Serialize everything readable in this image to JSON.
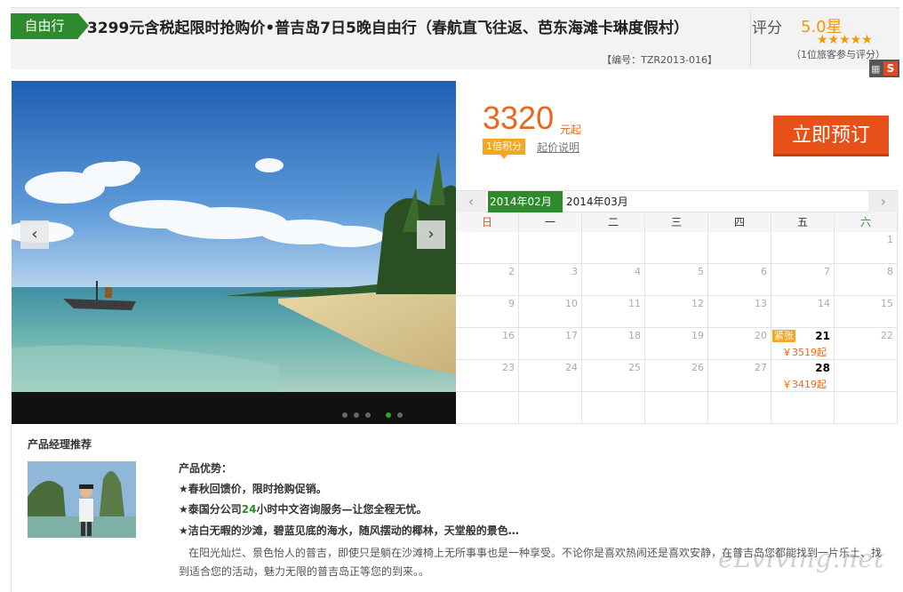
{
  "header": {
    "tag": "自由行",
    "title": "3299元含税起限时抢购价•普吉岛7日5晚自由行（春航直飞往返、芭东海滩卡琳度假村）",
    "code": "【编号：TZR2013-016】",
    "rating_label": "评分",
    "rating_value": "5.0星",
    "stars": "★★★★★",
    "reviews": "（1位旅客参与评分）"
  },
  "slider": {
    "prev_icon": "‹",
    "next_icon": "›",
    "total_slides": 5,
    "active_slide": 4
  },
  "price": {
    "amount": "3320",
    "unit": "元起",
    "points": "1倍积分",
    "note": "起价说明",
    "book_button": "立即预订"
  },
  "calendar": {
    "prev_icon": "‹",
    "next_icon": "›",
    "months": [
      "2014年02月",
      "2014年03月"
    ],
    "weekdays": [
      "日",
      "一",
      "二",
      "三",
      "四",
      "五",
      "六"
    ],
    "weekday_colors": [
      "#e8501a",
      "#333333",
      "#333333",
      "#333333",
      "#333333",
      "#333333",
      "#2d8b2d"
    ],
    "weeks": [
      [
        "",
        "",
        "",
        "",
        "",
        "",
        "1"
      ],
      [
        "2",
        "3",
        "4",
        "5",
        "6",
        "7",
        "8"
      ],
      [
        "9",
        "10",
        "11",
        "12",
        "13",
        "14",
        "15"
      ],
      [
        "16",
        "17",
        "18",
        "19",
        "20",
        "21",
        "22"
      ],
      [
        "23",
        "24",
        "25",
        "26",
        "27",
        "28",
        ""
      ],
      [
        "",
        "",
        "",
        "",
        "",
        "",
        ""
      ]
    ],
    "available": [
      {
        "day": "21",
        "price": "￥3519起",
        "tag": "紧张"
      },
      {
        "day": "28",
        "price": "￥3419起",
        "tag": ""
      }
    ]
  },
  "recommendation": {
    "title": "产品经理推荐",
    "advantages_title": "产品优势：",
    "lines": [
      {
        "prefix": "★春秋回馈价，限时抢购促销。",
        "highlight": "",
        "suffix": ""
      },
      {
        "prefix": "★泰国分公司",
        "highlight": "24",
        "suffix": "小时中文咨询服务—让您全程无忧。"
      },
      {
        "prefix": "★洁白无暇的沙滩，碧蓝见底的海水，随风摆动的椰林，天堂般的景色…",
        "highlight": "",
        "suffix": ""
      }
    ],
    "description": "在阳光灿烂、景色怡人的普吉，即使只是躺在沙滩椅上无所事事也是一种享受。不论你是喜欢热闹还是喜欢安静，在普吉岛您都能找到一片乐土、找到适合您的活动，魅力无限的普吉岛正等您的到来。。"
  },
  "watermark": "eLviving.net",
  "colors": {
    "brand_green": "#2d8b2d",
    "price_orange": "#e8671e",
    "button_orange": "#e8501a",
    "star_orange": "#f39800"
  }
}
